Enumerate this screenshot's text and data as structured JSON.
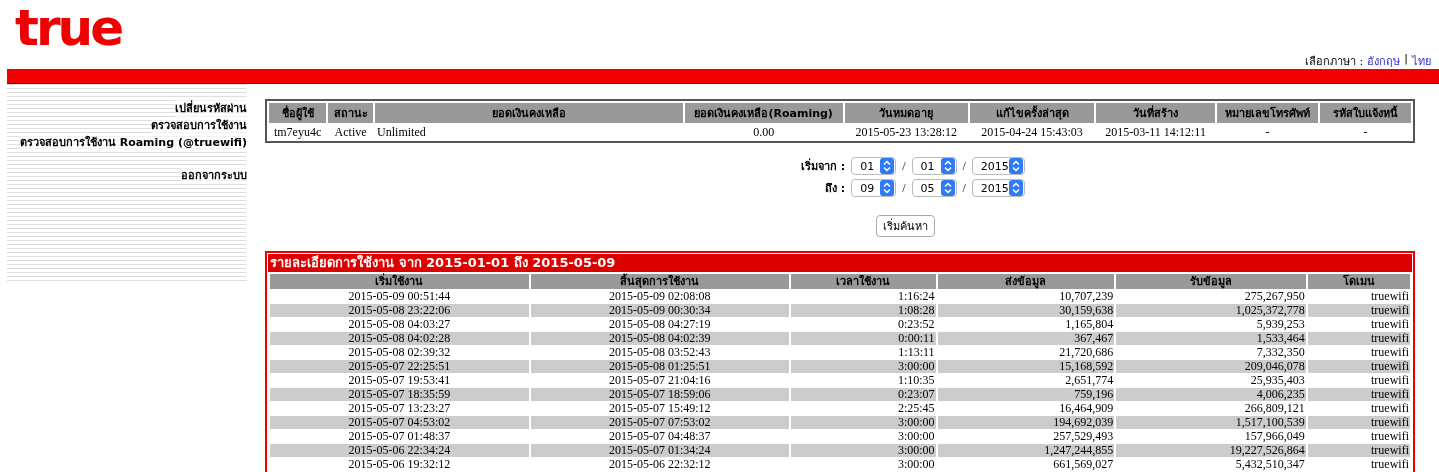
{
  "logo": {
    "text": "true"
  },
  "language": {
    "label": "เลือกภาษา :",
    "options": [
      {
        "label": "อังกฤษ"
      },
      {
        "label": "ไทย"
      }
    ],
    "separator": "|"
  },
  "sidebar": {
    "groups": [
      [
        "เปลี่ยนรหัสผ่าน",
        "ตรวจสอบการใช้งาน",
        "ตรวจสอบการใช้งาน Roaming (@truewifi)"
      ],
      [
        "ออกจากระบบ"
      ]
    ]
  },
  "account_table": {
    "columns": [
      "ชื่อผู้ใช้",
      "สถานะ",
      "ยอดเงินคงเหลือ",
      "ยอดเงินคงเหลือ(Roaming)",
      "วันหมดอายุ",
      "แก้ไขครั้งล่าสุด",
      "วันที่สร้าง",
      "หมายเลขโทรศัพท์",
      "รหัสใบแจ้งหนี้"
    ],
    "rows": [
      [
        "tm7eyu4c",
        "Active",
        "Unlimited",
        "0.00",
        "2015-05-23 13:28:12",
        "2015-04-24 15:43:03",
        "2015-03-11 14:12:11",
        "-",
        "-"
      ]
    ]
  },
  "date_range": {
    "from_label": "เริ่มจาก :",
    "from": [
      "01",
      "01",
      "2015"
    ],
    "to_label": "ถึง :",
    "to": [
      "09",
      "05",
      "2015"
    ],
    "separator": "/",
    "search_button": "เริ่มค้นหา"
  },
  "usage_table": {
    "title": "รายละเอียดการใช้งาน จาก 2015-01-01 ถึง 2015-05-09",
    "columns": [
      "เริ่มใช้งาน",
      "สิ้นสุดการใช้งาน",
      "เวลาใช้งาน",
      "ส่งข้อมูล",
      "รับข้อมูล",
      "โดเมน"
    ],
    "rows": [
      [
        "2015-05-09 00:51:44",
        "2015-05-09 02:08:08",
        "1:16:24",
        "10,707,239",
        "275,267,950",
        "truewifi"
      ],
      [
        "2015-05-08 23:22:06",
        "2015-05-09 00:30:34",
        "1:08:28",
        "30,159,638",
        "1,025,372,778",
        "truewifi"
      ],
      [
        "2015-05-08 04:03:27",
        "2015-05-08 04:27:19",
        "0:23:52",
        "1,165,804",
        "5,939,253",
        "truewifi"
      ],
      [
        "2015-05-08 04:02:28",
        "2015-05-08 04:02:39",
        "0:00:11",
        "367,467",
        "1,533,464",
        "truewifi"
      ],
      [
        "2015-05-08 02:39:32",
        "2015-05-08 03:52:43",
        "1:13:11",
        "21,720,686",
        "7,332,350",
        "truewifi"
      ],
      [
        "2015-05-07 22:25:51",
        "2015-05-08 01:25:51",
        "3:00:00",
        "15,168,592",
        "209,046,078",
        "truewifi"
      ],
      [
        "2015-05-07 19:53:41",
        "2015-05-07 21:04:16",
        "1:10:35",
        "2,651,774",
        "25,935,403",
        "truewifi"
      ],
      [
        "2015-05-07 18:35:59",
        "2015-05-07 18:59:06",
        "0:23:07",
        "759,196",
        "4,006,235",
        "truewifi"
      ],
      [
        "2015-05-07 13:23:27",
        "2015-05-07 15:49:12",
        "2:25:45",
        "16,464,909",
        "266,809,121",
        "truewifi"
      ],
      [
        "2015-05-07 04:53:02",
        "2015-05-07 07:53:02",
        "3:00:00",
        "194,692,039",
        "1,517,100,539",
        "truewifi"
      ],
      [
        "2015-05-07 01:48:37",
        "2015-05-07 04:48:37",
        "3:00:00",
        "257,529,493",
        "157,966,049",
        "truewifi"
      ],
      [
        "2015-05-06 22:34:24",
        "2015-05-07 01:34:24",
        "3:00:00",
        "1,247,244,855",
        "19,227,526,864",
        "truewifi"
      ],
      [
        "2015-05-06 19:32:12",
        "2015-05-06 22:32:12",
        "3:00:00",
        "661,569,027",
        "5,432,510,347",
        "truewifi"
      ]
    ]
  }
}
